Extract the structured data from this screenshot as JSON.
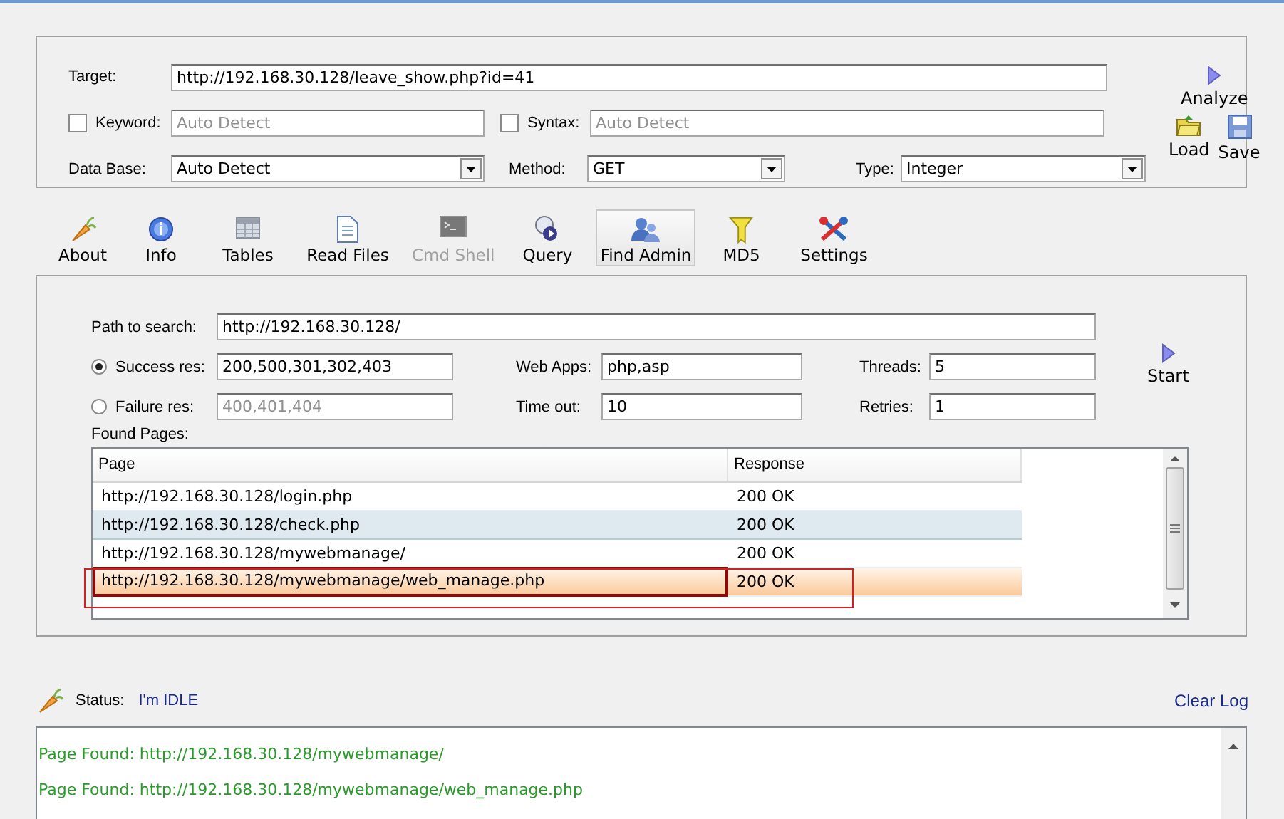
{
  "target": {
    "label": "Target:",
    "value": "http://192.168.30.128/leave_show.php?id=41"
  },
  "keyword": {
    "label": "Keyword:",
    "checked": false,
    "placeholder": "Auto Detect"
  },
  "syntax": {
    "label": "Syntax:",
    "checked": false,
    "placeholder": "Auto Detect"
  },
  "database": {
    "label": "Data Base:",
    "value": "Auto Detect"
  },
  "method": {
    "label": "Method:",
    "value": "GET"
  },
  "type": {
    "label": "Type:",
    "value": "Integer"
  },
  "side_buttons": [
    {
      "kind": "play",
      "label": "Analyze"
    },
    {
      "kind": "folder",
      "label": "Load"
    },
    {
      "kind": "disk",
      "label": "Save"
    }
  ],
  "toolbar": [
    {
      "kind": "carrot",
      "label": "About",
      "selected": false,
      "disabled": false
    },
    {
      "kind": "info",
      "label": "Info",
      "selected": false,
      "disabled": false
    },
    {
      "kind": "table",
      "label": "Tables",
      "selected": false,
      "disabled": false
    },
    {
      "kind": "file",
      "label": "Read Files",
      "selected": false,
      "disabled": false
    },
    {
      "kind": "terminal",
      "label": "Cmd Shell",
      "selected": false,
      "disabled": true
    },
    {
      "kind": "query",
      "label": "Query",
      "selected": false,
      "disabled": false
    },
    {
      "kind": "users",
      "label": "Find Admin",
      "selected": true,
      "disabled": false
    },
    {
      "kind": "key",
      "label": "MD5",
      "selected": false,
      "disabled": false
    },
    {
      "kind": "tools",
      "label": "Settings",
      "selected": false,
      "disabled": false
    }
  ],
  "admin": {
    "path": {
      "label": "Path to search:",
      "value": "http://192.168.30.128/"
    },
    "success": {
      "label": "Success res:",
      "selected": true,
      "value": "200,500,301,302,403"
    },
    "failure": {
      "label": "Failure res:",
      "selected": false,
      "value": "400,401,404"
    },
    "web_apps": {
      "label": "Web Apps:",
      "value": "php,asp"
    },
    "timeout": {
      "label": "Time out:",
      "value": "10"
    },
    "threads": {
      "label": "Threads:",
      "value": "5"
    },
    "retries": {
      "label": "Retries:",
      "value": "1"
    },
    "start": {
      "label": "Start"
    },
    "found_label": "Found Pages:",
    "table": {
      "columns": [
        "Page",
        "Response"
      ],
      "rows": [
        {
          "page": "http://192.168.30.128/login.php",
          "response": "200 OK",
          "selected": false,
          "hovered": false,
          "outlined": false
        },
        {
          "page": "http://192.168.30.128/check.php",
          "response": "200 OK",
          "selected": false,
          "hovered": true,
          "outlined": false
        },
        {
          "page": "http://192.168.30.128/mywebmanage/",
          "response": "200 OK",
          "selected": false,
          "hovered": false,
          "outlined": false
        },
        {
          "page": "http://192.168.30.128/mywebmanage/web_manage.php",
          "response": "200 OK",
          "selected": true,
          "hovered": false,
          "outlined": true
        }
      ]
    }
  },
  "status": {
    "label": "Status:",
    "value": "I'm IDLE",
    "clear_log": "Clear Log"
  },
  "log": [
    {
      "text": "Page Found: http://192.168.30.128/mywebmanage/",
      "color": "#2a9a2a"
    },
    {
      "text": "Page Found: http://192.168.30.128/mywebmanage/web_manage.php",
      "color": "#2a9a2a"
    }
  ]
}
